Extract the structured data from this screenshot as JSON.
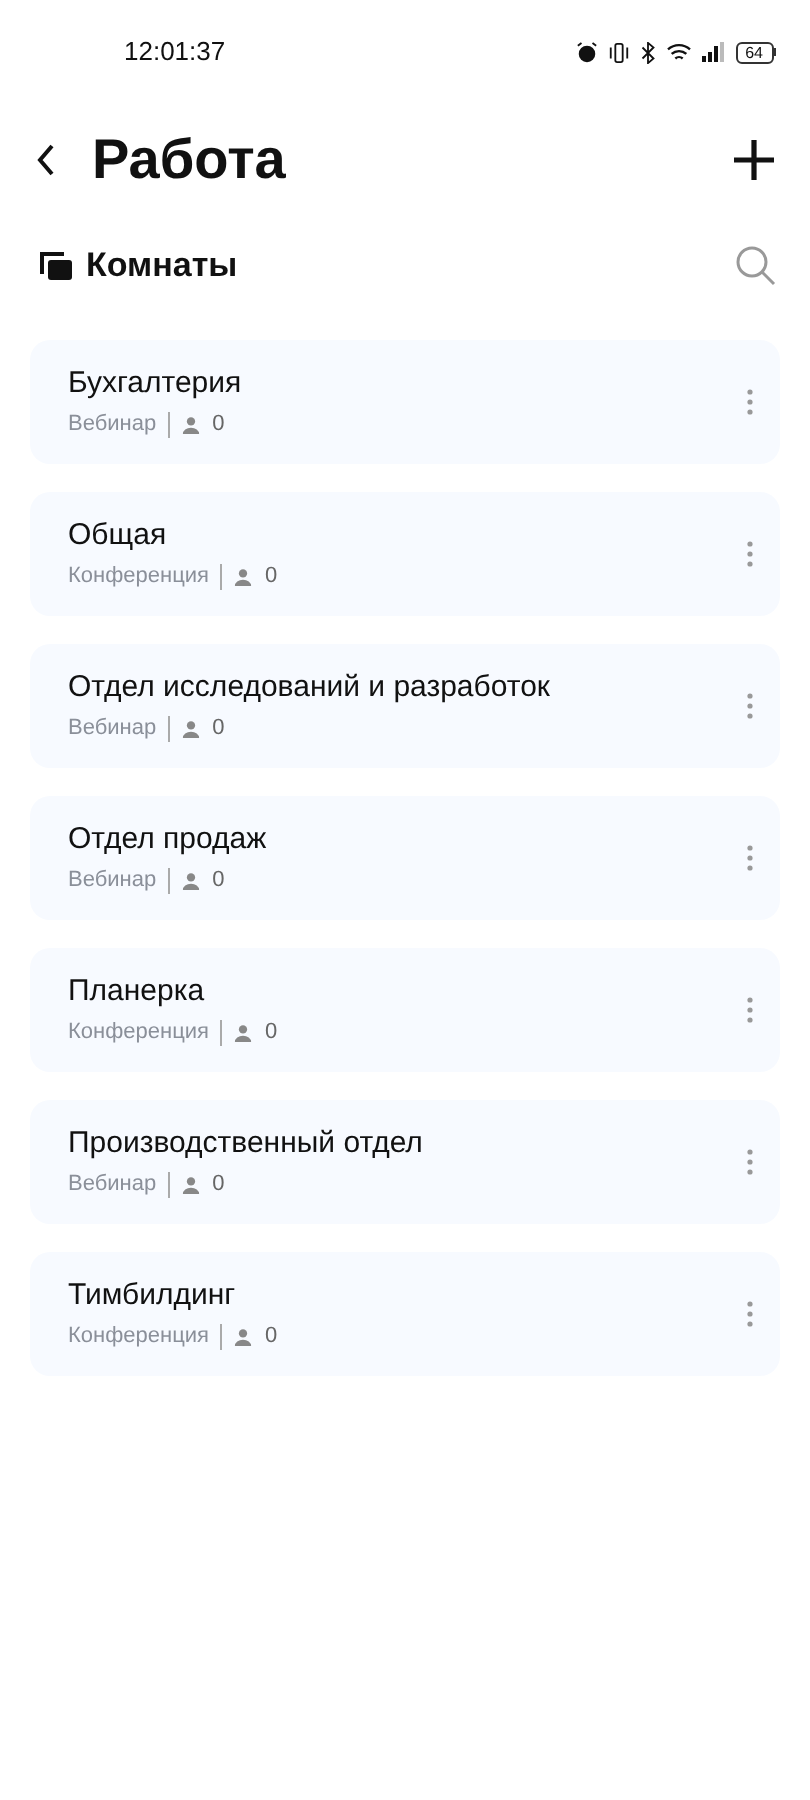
{
  "status_bar": {
    "time": "12:01:37",
    "battery": "64"
  },
  "header": {
    "title": "Работа"
  },
  "section": {
    "title": "Комнаты"
  },
  "rooms": [
    {
      "name": "Бухгалтерия",
      "type": "Вебинар",
      "participants": "0"
    },
    {
      "name": "Общая",
      "type": "Конференция",
      "participants": "0"
    },
    {
      "name": "Отдел исследований и разработок",
      "type": "Вебинар",
      "participants": "0"
    },
    {
      "name": "Отдел продаж",
      "type": "Вебинар",
      "participants": "0"
    },
    {
      "name": "Планерка",
      "type": "Конференция",
      "participants": "0"
    },
    {
      "name": "Производственный отдел",
      "type": "Вебинар",
      "participants": "0"
    },
    {
      "name": "Тимбилдинг",
      "type": "Конференция",
      "participants": "0"
    }
  ]
}
